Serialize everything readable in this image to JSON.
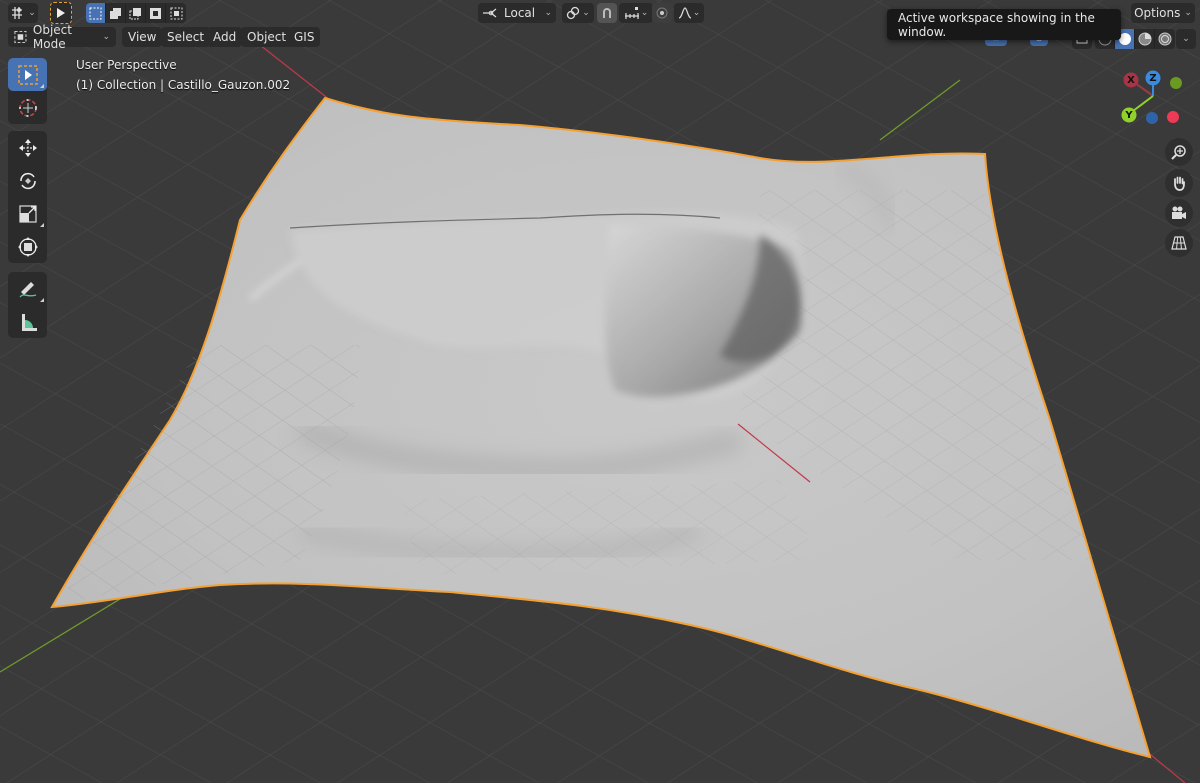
{
  "header": {
    "editor_type_icon": "3d-viewport-icon",
    "select_tool_icon": "cursor-arrow-icon",
    "selection_modes": [
      "set",
      "extend",
      "subtract",
      "invert",
      "intersect"
    ],
    "transform_orientation": "Local",
    "pivot_icon": "pivot-link-icon",
    "snap_icon": "magnet-icon",
    "snap_target_icon": "snap-increment-icon",
    "proportional_edit_icon": "proportional-circle-icon",
    "falloff_icon": "falloff-curve-icon",
    "options_label": "Options"
  },
  "menubar": {
    "mode": "Object Mode",
    "items": [
      "View",
      "Select",
      "Add",
      "Object",
      "GIS"
    ]
  },
  "viewport": {
    "view_name": "User Perspective",
    "collection_info": "(1) Collection | Castillo_Gauzon.002",
    "object_name": "Castillo_Gauzon.002",
    "selection_outline_color": "#f5a030",
    "x_axis_color": "#d83d4a",
    "y_axis_color": "#7ab82b",
    "z_axis_color": "#3a8ae0"
  },
  "toolbar": {
    "tools": [
      {
        "name": "select-box",
        "icon": "select-box-icon",
        "active": true
      },
      {
        "name": "cursor",
        "icon": "3d-cursor-icon",
        "active": false
      },
      {
        "name": "move",
        "icon": "move-icon",
        "active": false
      },
      {
        "name": "rotate",
        "icon": "rotate-icon",
        "active": false
      },
      {
        "name": "scale",
        "icon": "scale-icon",
        "active": false
      },
      {
        "name": "transform",
        "icon": "transform-icon",
        "active": false
      },
      {
        "name": "annotate",
        "icon": "annotate-pencil-icon",
        "active": false
      },
      {
        "name": "measure",
        "icon": "measure-ruler-icon",
        "active": false
      }
    ]
  },
  "gizmo": {
    "x_label": "X",
    "y_label": "Y",
    "z_label": "Z"
  },
  "navigation": {
    "buttons": [
      "zoom-icon",
      "hand-pan-icon",
      "camera-icon",
      "ortho-grid-icon"
    ]
  },
  "shading": {
    "modes": [
      "wireframe",
      "solid",
      "material-preview",
      "rendered"
    ],
    "active": "solid"
  },
  "tooltip": {
    "text": "Active workspace showing in the window."
  }
}
